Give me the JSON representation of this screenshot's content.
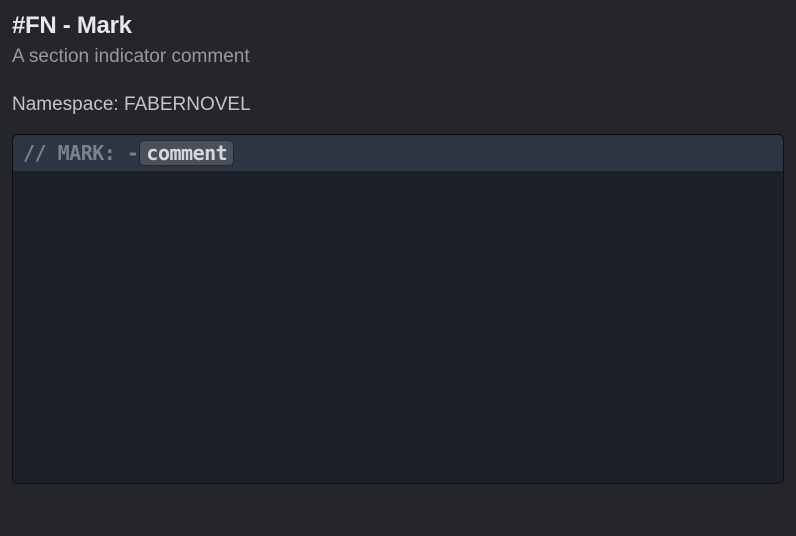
{
  "header": {
    "title": "#FN - Mark",
    "subtitle": "A section indicator comment",
    "namespace_label": "Namespace: ",
    "namespace_value": "FABERNOVEL"
  },
  "code": {
    "prefix": "// MARK: - ",
    "placeholder": "comment"
  }
}
